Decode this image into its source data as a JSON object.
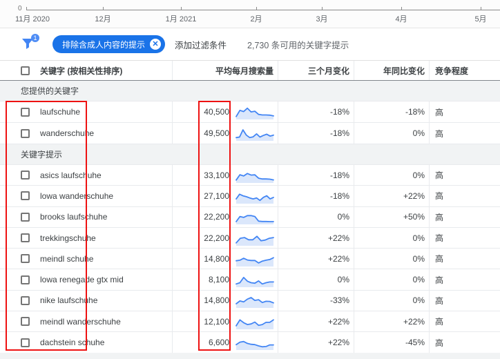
{
  "timeline": {
    "y_zero_label": "0",
    "months": [
      {
        "label": "11月 2020"
      },
      {
        "label": "12月"
      },
      {
        "label": "1月 2021"
      },
      {
        "label": "2月"
      },
      {
        "label": "3月"
      },
      {
        "label": "4月"
      },
      {
        "label": "5月"
      }
    ]
  },
  "filter_bar": {
    "badge_count": "1",
    "chip_label": "排除含成人内容的提示",
    "chip_close": "✕",
    "add_filter_label": "添加过滤条件",
    "available_count_text": "2,730 条可用的关键字提示"
  },
  "table": {
    "headers": {
      "keyword": "关键字 (按相关性排序)",
      "avg_monthly_searches": "平均每月搜索量",
      "three_month_change": "三个月变化",
      "yoy_change": "年同比变化",
      "competition": "竞争程度"
    },
    "sections": [
      {
        "title": "您提供的关键字",
        "rows": [
          {
            "keyword": "laufschuhe",
            "avg_monthly_searches": "40,500",
            "three_month_change": "-18%",
            "yoy_change": "-18%",
            "competition": "高",
            "sparkline": [
              15,
              65,
              55,
              82,
              52,
              58,
              32,
              28,
              28,
              26,
              20
            ]
          },
          {
            "keyword": "wanderschuhe",
            "avg_monthly_searches": "49,500",
            "three_month_change": "-18%",
            "yoy_change": "0%",
            "competition": "高",
            "sparkline": [
              18,
              22,
              80,
              38,
              18,
              24,
              48,
              22,
              35,
              45,
              30,
              38
            ]
          }
        ]
      },
      {
        "title": "关键字提示",
        "rows": [
          {
            "keyword": "asics laufschuhe",
            "avg_monthly_searches": "33,100",
            "three_month_change": "-18%",
            "yoy_change": "0%",
            "competition": "高",
            "sparkline": [
              15,
              58,
              48,
              68,
              55,
              57,
              30,
              24,
              24,
              22,
              16
            ]
          },
          {
            "keyword": "lowa wanderschuhe",
            "avg_monthly_searches": "27,100",
            "three_month_change": "-18%",
            "yoy_change": "+22%",
            "competition": "高",
            "sparkline": [
              30,
              68,
              55,
              48,
              38,
              30,
              38,
              18,
              42,
              55,
              30,
              42
            ]
          },
          {
            "keyword": "brooks laufschuhe",
            "avg_monthly_searches": "22,200",
            "three_month_change": "0%",
            "yoy_change": "+50%",
            "competition": "高",
            "sparkline": [
              14,
              55,
              48,
              62,
              62,
              55,
              18,
              15,
              15,
              14,
              14
            ]
          },
          {
            "keyword": "trekkingschuhe",
            "avg_monthly_searches": "22,200",
            "three_month_change": "+22%",
            "yoy_change": "0%",
            "competition": "高",
            "sparkline": [
              15,
              52,
              58,
              40,
              40,
              68,
              32,
              38,
              52,
              58
            ]
          },
          {
            "keyword": "meindl schuhe",
            "avg_monthly_searches": "14,800",
            "three_month_change": "+22%",
            "yoy_change": "0%",
            "competition": "高",
            "sparkline": [
              38,
              42,
              58,
              44,
              40,
              40,
              20,
              35,
              42,
              48,
              62
            ]
          },
          {
            "keyword": "lowa renegade gtx mid",
            "avg_monthly_searches": "8,100",
            "three_month_change": "0%",
            "yoy_change": "0%",
            "competition": "高",
            "sparkline": [
              18,
              28,
              70,
              40,
              28,
              24,
              42,
              18,
              28,
              34,
              34
            ]
          },
          {
            "keyword": "nike laufschuhe",
            "avg_monthly_searches": "14,800",
            "three_month_change": "-33%",
            "yoy_change": "0%",
            "competition": "高",
            "sparkline": [
              25,
              48,
              40,
              62,
              75,
              52,
              58,
              35,
              45,
              44,
              32
            ]
          },
          {
            "keyword": "meindl wanderschuhe",
            "avg_monthly_searches": "12,100",
            "three_month_change": "+22%",
            "yoy_change": "+22%",
            "competition": "高",
            "sparkline": [
              20,
              68,
              45,
              30,
              35,
              50,
              24,
              30,
              48,
              48,
              68
            ]
          },
          {
            "keyword": "dachstein schuhe",
            "avg_monthly_searches": "6,600",
            "three_month_change": "+22%",
            "yoy_change": "-45%",
            "competition": "高",
            "sparkline": [
              35,
              55,
              60,
              45,
              38,
              35,
              25,
              18,
              20,
              33,
              33
            ]
          }
        ]
      }
    ]
  },
  "colors": {
    "accent_blue": "#1a73e8",
    "sparkline_blue": "#4285f4",
    "sparkline_fill": "#dbe7fb",
    "annotation_red": "#ee1111"
  }
}
